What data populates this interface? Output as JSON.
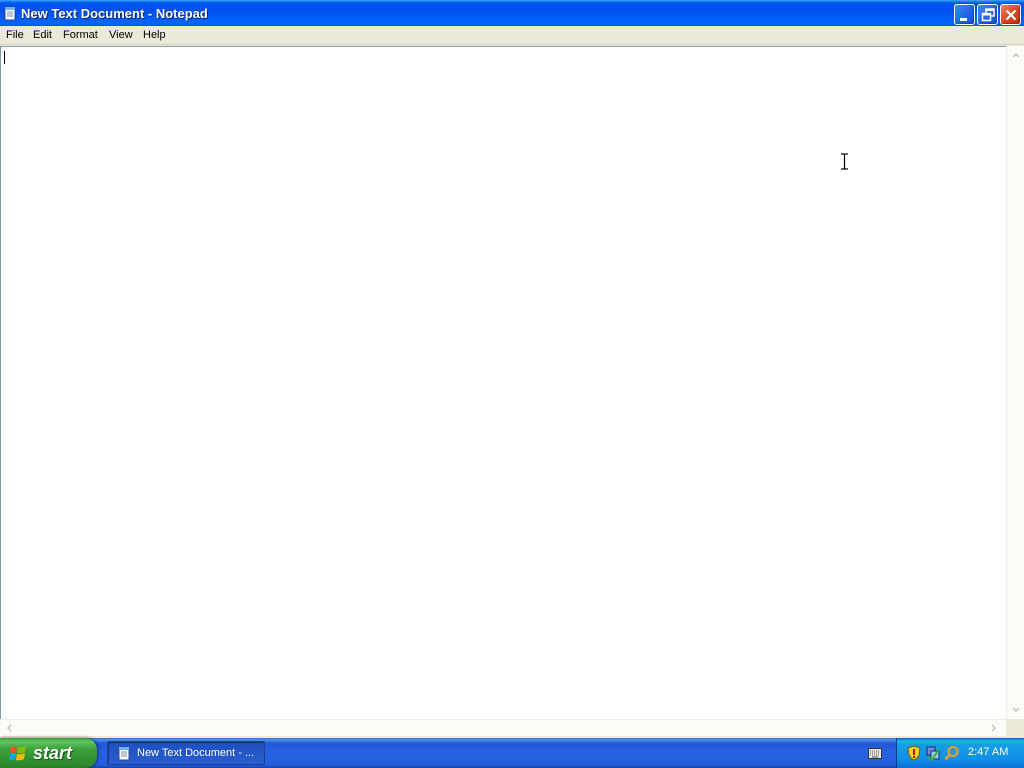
{
  "window": {
    "title": "New Text Document - Notepad"
  },
  "menubar": {
    "items": [
      "File",
      "Edit",
      "Format",
      "View",
      "Help"
    ]
  },
  "editor": {
    "content": ""
  },
  "taskbar": {
    "start_label": "start",
    "task_button_label": "New Text Document - ...",
    "clock": "2:47 AM"
  },
  "icons": {
    "title": "notepad-icon",
    "minimize": "minimize-icon",
    "restore": "restore-icon",
    "close": "close-icon",
    "start": "windows-logo-icon",
    "keyboard": "keyboard-icon",
    "tray": [
      "security-shield-icon",
      "network-icon",
      "search-icon"
    ]
  },
  "colors": {
    "titlebar": "#0053ee",
    "close_button": "#d6481f",
    "start_button": "#3a9e3a",
    "taskbar": "#245edc",
    "tray": "#1290e8",
    "editor_bg": "#ffffff",
    "chrome": "#ece9d8"
  }
}
